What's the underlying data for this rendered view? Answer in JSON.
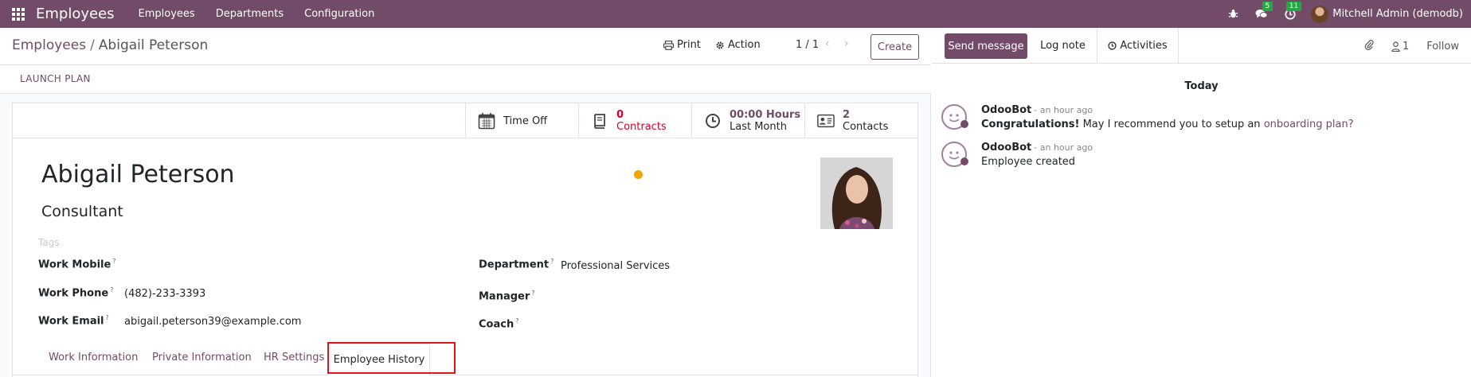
{
  "navbar": {
    "app_name": "Employees",
    "menu": [
      "Employees",
      "Departments",
      "Configuration"
    ],
    "messages_count": "5",
    "activities_count": "11",
    "user_name": "Mitchell Admin (demodb)"
  },
  "control": {
    "breadcrumb_parent": "Employees",
    "breadcrumb_sep": "/",
    "breadcrumb_current": "Abigail Peterson",
    "print_label": "Print",
    "action_label": "Action",
    "pager": "1 / 1",
    "create_label": "Create",
    "launch_plan_label": "LAUNCH PLAN"
  },
  "smart_buttons": {
    "time_off": "Time Off",
    "contracts_value": "0",
    "contracts_label": "Contracts",
    "hours_value": "00:00 Hours",
    "hours_label": "Last Month",
    "contacts_value": "2",
    "contacts_label": "Contacts"
  },
  "employee": {
    "name": "Abigail Peterson",
    "job_title": "Consultant",
    "tags_placeholder": "Tags",
    "work_mobile_label": "Work Mobile",
    "work_mobile": "",
    "work_phone_label": "Work Phone",
    "work_phone": "(482)-233-3393",
    "work_email_label": "Work Email",
    "work_email": "abigail.peterson39@example.com",
    "department_label": "Department",
    "department": "Professional Services",
    "manager_label": "Manager",
    "manager": "",
    "coach_label": "Coach",
    "coach": "",
    "help_mark": "?"
  },
  "tabs": [
    "Work Information",
    "Private Information",
    "HR Settings",
    "Employee History"
  ],
  "chatter": {
    "send_message": "Send message",
    "log_note": "Log note",
    "activities": "Activities",
    "followers_count": "1",
    "follow": "Follow",
    "date_separator": "Today",
    "messages": [
      {
        "author": "OdooBot",
        "time": "- an hour ago",
        "body_bold": "Congratulations!",
        "body_text": " May I recommend you to setup an ",
        "body_link": "onboarding plan?"
      },
      {
        "author": "OdooBot",
        "time": "- an hour ago",
        "body_text": "Employee created"
      }
    ]
  },
  "colors": {
    "brand": "#714B67",
    "badge": "#28a745",
    "danger": "#d9012c",
    "highlight": "#e0141e"
  }
}
